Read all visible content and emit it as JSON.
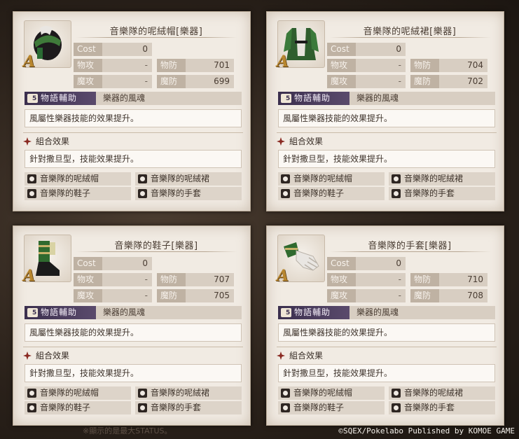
{
  "cards": [
    {
      "name": "音樂隊的呢絨帽[樂器]",
      "item_icon": "hat-icon",
      "rank": "A",
      "cost_label": "Cost",
      "cost": "0",
      "patk_label": "物攻",
      "patk": "-",
      "matk_label": "魔攻",
      "matk": "-",
      "pdef_label": "物防",
      "pdef": "701",
      "mdef_label": "魔防",
      "mdef": "699",
      "support_label": "物語輔助",
      "support_name": "樂器的風魂",
      "support_desc": "風屬性樂器技能的效果提升。",
      "combo_label": "組合效果",
      "combo_desc": "針對撒旦型，技能效果提升。",
      "set": [
        "音樂隊的呢絨帽",
        "音樂隊的呢絨裙",
        "音樂隊的鞋子",
        "音樂隊的手套"
      ]
    },
    {
      "name": "音樂隊的呢絨裙[樂器]",
      "item_icon": "coat-icon",
      "rank": "A",
      "cost_label": "Cost",
      "cost": "0",
      "patk_label": "物攻",
      "patk": "-",
      "matk_label": "魔攻",
      "matk": "-",
      "pdef_label": "物防",
      "pdef": "704",
      "mdef_label": "魔防",
      "mdef": "702",
      "support_label": "物語輔助",
      "support_name": "樂器的風魂",
      "support_desc": "風屬性樂器技能的效果提升。",
      "combo_label": "組合效果",
      "combo_desc": "針對撒旦型，技能效果提升。",
      "set": [
        "音樂隊的呢絨帽",
        "音樂隊的呢絨裙",
        "音樂隊的鞋子",
        "音樂隊的手套"
      ]
    },
    {
      "name": "音樂隊的鞋子[樂器]",
      "item_icon": "boots-icon",
      "rank": "A",
      "cost_label": "Cost",
      "cost": "0",
      "patk_label": "物攻",
      "patk": "-",
      "matk_label": "魔攻",
      "matk": "-",
      "pdef_label": "物防",
      "pdef": "707",
      "mdef_label": "魔防",
      "mdef": "705",
      "support_label": "物語輔助",
      "support_name": "樂器的風魂",
      "support_desc": "風屬性樂器技能的效果提升。",
      "combo_label": "組合效果",
      "combo_desc": "針對撒旦型，技能效果提升。",
      "set": [
        "音樂隊的呢絨帽",
        "音樂隊的呢絨裙",
        "音樂隊的鞋子",
        "音樂隊的手套"
      ]
    },
    {
      "name": "音樂隊的手套[樂器]",
      "item_icon": "glove-icon",
      "rank": "A",
      "cost_label": "Cost",
      "cost": "0",
      "patk_label": "物攻",
      "patk": "-",
      "matk_label": "魔攻",
      "matk": "-",
      "pdef_label": "物防",
      "pdef": "710",
      "mdef_label": "魔防",
      "mdef": "708",
      "support_label": "物語輔助",
      "support_name": "樂器的風魂",
      "support_desc": "風屬性樂器技能的效果提升。",
      "combo_label": "組合效果",
      "combo_desc": "針對撒旦型，技能效果提升。",
      "set": [
        "音樂隊的呢絨帽",
        "音樂隊的呢絨裙",
        "音樂隊的鞋子",
        "音樂隊的手套"
      ]
    }
  ],
  "footer_note": "※顯示的是最大STATUS。",
  "copyright": "©SQEX/Pokelabo Published by KOMOE GAME"
}
